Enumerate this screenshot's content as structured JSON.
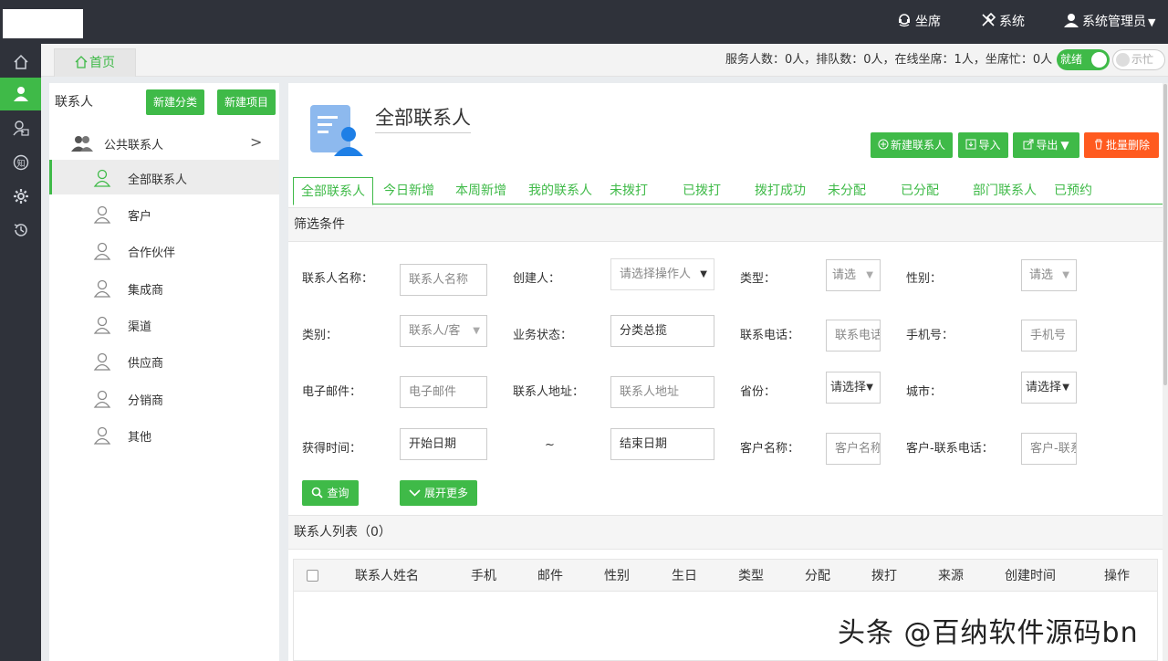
{
  "topbar": {
    "seat": "坐席",
    "system": "系统",
    "admin": "系统管理员"
  },
  "tabs_row": {
    "home": "首页",
    "stats": "服务人数：0人，排队数：0人，在线坐席：1人，坐席忙：0人",
    "toggle_ready": "就绪",
    "toggle_busy": "示忙"
  },
  "left": {
    "title": "联系人",
    "new_category": "新建分类",
    "new_item": "新建项目",
    "group": "公共联系人",
    "items": [
      {
        "label": "全部联系人",
        "active": true
      },
      {
        "label": "客户",
        "active": false
      },
      {
        "label": "合作伙伴",
        "active": false
      },
      {
        "label": "集成商",
        "active": false
      },
      {
        "label": "渠道",
        "active": false
      },
      {
        "label": "供应商",
        "active": false
      },
      {
        "label": "分销商",
        "active": false
      },
      {
        "label": "其他",
        "active": false
      }
    ]
  },
  "main": {
    "title": "全部联系人",
    "buttons": {
      "new_contact": "新建联系人",
      "import": "导入",
      "export": "导出",
      "batch_delete": "批量删除"
    },
    "tabs": [
      "全部联系人",
      "今日新增",
      "本周新增",
      "我的联系人",
      "未拨打",
      "已拨打",
      "拨打成功",
      "未分配",
      "已分配",
      "部门联系人",
      "已预约"
    ],
    "filter_title": "筛选条件",
    "filters": {
      "name_label": "联系人名称：",
      "name_ph": "联系人名称",
      "creator_label": "创建人：",
      "creator_ph": "请选择操作人",
      "type_label": "类型：",
      "type_ph": "请选",
      "gender_label": "性别：",
      "gender_ph": "请选",
      "category_label": "类别：",
      "category_value": "联系人/客",
      "status_label": "业务状态：",
      "status_value": "分类总揽",
      "phone_label": "联系电话：",
      "phone_ph": "联系电话",
      "mobile_label": "手机号：",
      "mobile_ph": "手机号",
      "email_label": "电子邮件：",
      "email_ph": "电子邮件",
      "address_label": "联系人地址：",
      "address_ph": "联系人地址",
      "province_label": "省份：",
      "province_ph": "请选择",
      "city_label": "城市：",
      "city_ph": "请选择",
      "time_label": "获得时间：",
      "start_ph": "开始日期",
      "tilde": "~",
      "end_ph": "结束日期",
      "customer_label": "客户名称：",
      "customer_ph": "客户名称",
      "cust_phone_label": "客户-联系电话：",
      "cust_phone_ph": "客户-联系电话"
    },
    "query": "查询",
    "expand": "展开更多",
    "list_title": "联系人列表（0）",
    "columns": [
      "联系人姓名",
      "手机",
      "邮件",
      "性别",
      "生日",
      "类型",
      "分配",
      "拨打",
      "来源",
      "创建时间",
      "操作"
    ]
  },
  "watermark": "头条 @百纳软件源码bn",
  "colors": {
    "accent": "#3fba48",
    "danger": "#ff5a1f",
    "dark": "#2f323a"
  }
}
